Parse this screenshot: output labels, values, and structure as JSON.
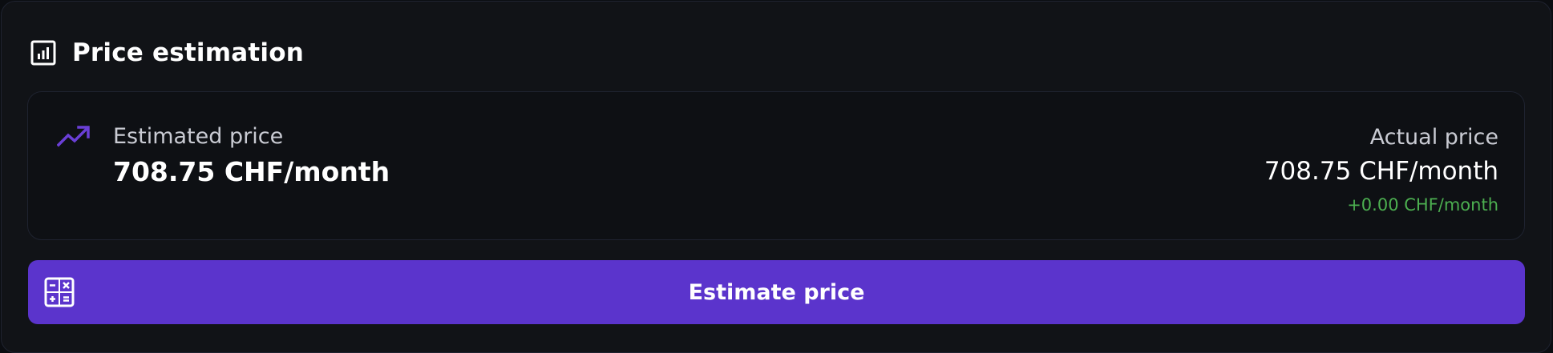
{
  "header": {
    "title": "Price estimation",
    "icon": "bar-chart-box-icon"
  },
  "estimate": {
    "icon": "trending-up-icon",
    "label": "Estimated price",
    "value": "708.75 CHF/month"
  },
  "actual": {
    "label": "Actual price",
    "value": "708.75 CHF/month",
    "difference": "+0.00 CHF/month"
  },
  "button": {
    "label": "Estimate price",
    "icon": "calculator-icon"
  },
  "colors": {
    "accent": "#5b34cc",
    "trend_icon": "#6a3fd6",
    "positive": "#4caf50",
    "background": "#111317"
  }
}
